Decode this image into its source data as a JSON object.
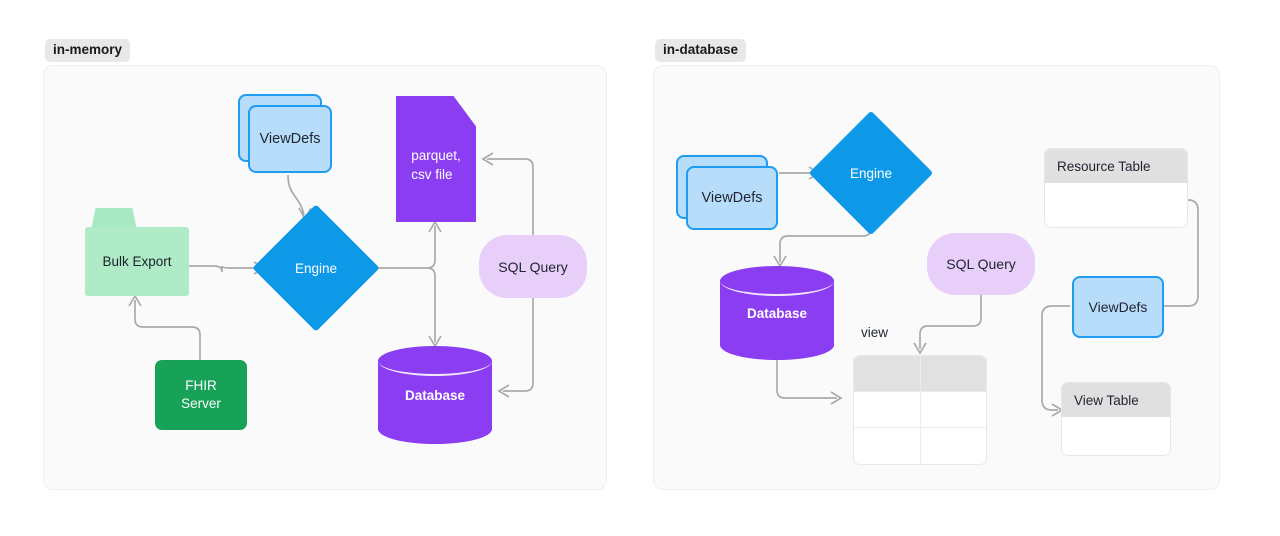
{
  "panels": [
    {
      "id": "in-memory",
      "label": "in-memory",
      "nodes": {
        "viewdefs": "ViewDefs",
        "bulk_export": "Bulk Export",
        "fhir_server": "FHIR\nServer",
        "fhir_server_line1": "FHIR",
        "fhir_server_line2": "Server",
        "engine": "Engine",
        "file": "parquet,\ncsv file",
        "file_line1": "parquet,",
        "file_line2": "csv file",
        "sql_query": "SQL Query",
        "database": "Database"
      }
    },
    {
      "id": "in-database",
      "label": "in-database",
      "nodes": {
        "viewdefs": "ViewDefs",
        "engine": "Engine",
        "database": "Database",
        "sql_query": "SQL Query",
        "view_caption": "view",
        "resource_table": "Resource Table",
        "viewdefs_right": "ViewDefs",
        "view_table": "View Table"
      }
    }
  ],
  "colors": {
    "page_background": "#ffffff",
    "panel_background": "#fafafa",
    "panel_border": "#eeeeee",
    "badge_background": "#e8e8e8",
    "engine_blue": "#0d99e8",
    "viewdefs_fill": "#b8ddfb",
    "viewdefs_border": "#1f9cf0",
    "bulk_export_green": "#b0ebc8",
    "fhir_server_green": "#18a257",
    "purple": "#8b3df2",
    "sql_query_lavender": "#e8cffa",
    "table_header_gray": "#e0e0e0",
    "edge_gray": "#aaaaaa"
  }
}
